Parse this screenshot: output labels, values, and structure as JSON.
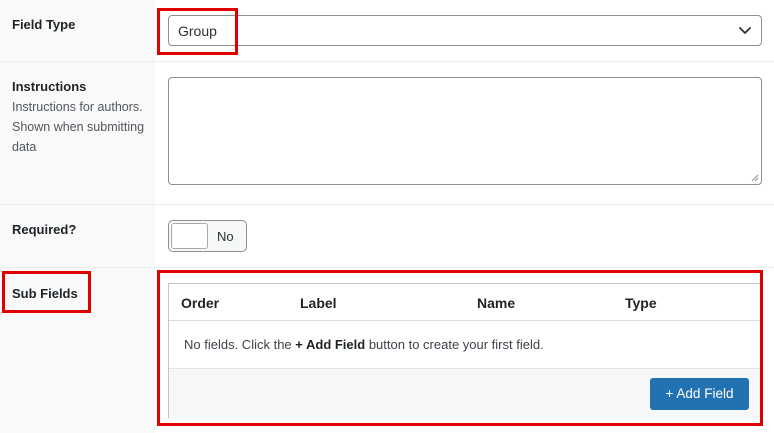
{
  "field_type": {
    "label": "Field Type",
    "value": "Group",
    "icon": "chevron-down-icon"
  },
  "instructions": {
    "label": "Instructions",
    "description": "Instructions for authors. Shown when submitting data",
    "value": ""
  },
  "required": {
    "label": "Required?",
    "toggle_text": "No"
  },
  "sub_fields": {
    "label": "Sub Fields",
    "columns": [
      "Order",
      "Label",
      "Name",
      "Type"
    ],
    "empty_text_before": "No fields. Click the ",
    "empty_text_link": "+ Add Field",
    "empty_text_after": " button to create your first field.",
    "add_button_label": "+ Add Field"
  },
  "colors": {
    "highlight": "#e00000",
    "primary_button": "#2271b1",
    "label_column_bg": "#f9f9f9"
  }
}
